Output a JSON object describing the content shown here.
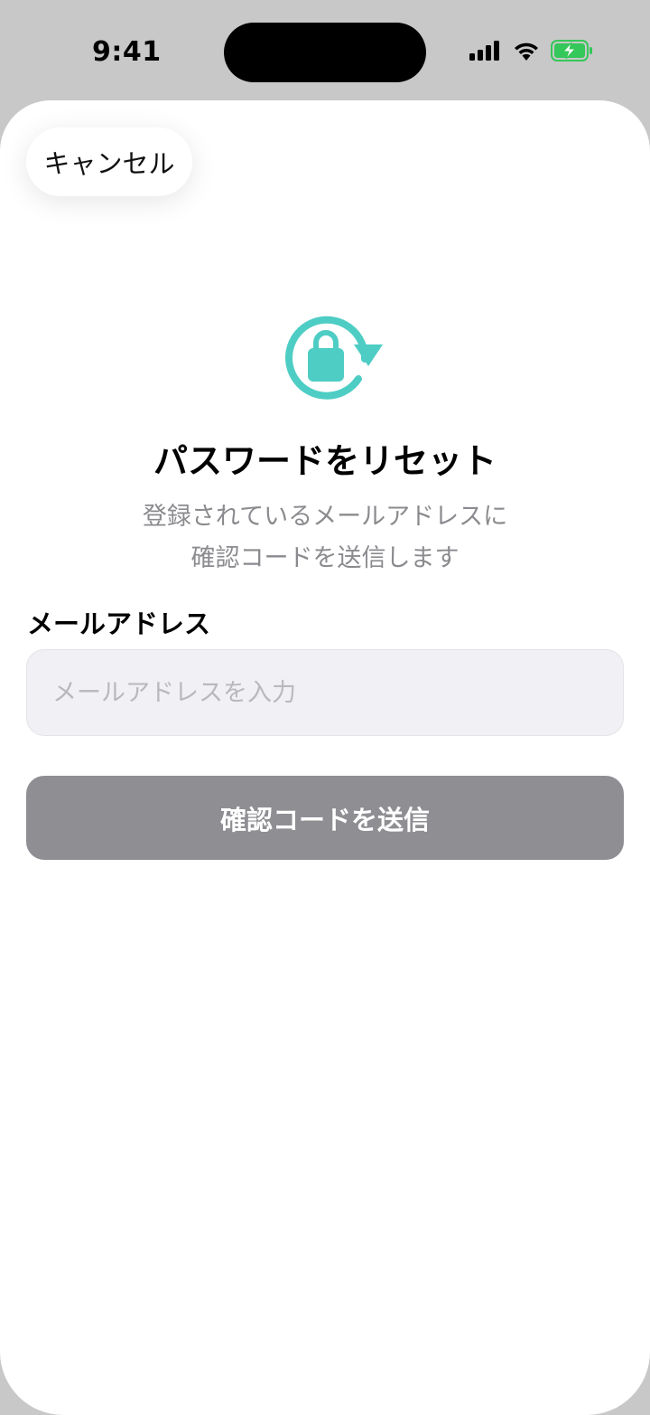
{
  "status_bar": {
    "time": "9:41",
    "icons": [
      "signal-icon",
      "wifi-icon",
      "battery-charging-icon"
    ],
    "battery_color": "#34c759"
  },
  "sheet": {
    "cancel_label": "キャンセル",
    "hero_icon": "lock-reset-icon",
    "accent_color": "#4ecdc4",
    "title": "パスワードをリセット",
    "description_line1": "登録されているメールアドレスに",
    "description_line2": "確認コードを送信します",
    "email": {
      "label": "メールアドレス",
      "value": "",
      "placeholder": "メールアドレスを入力"
    },
    "submit_label": "確認コードを送信",
    "submit_color": "#8e8e93"
  }
}
